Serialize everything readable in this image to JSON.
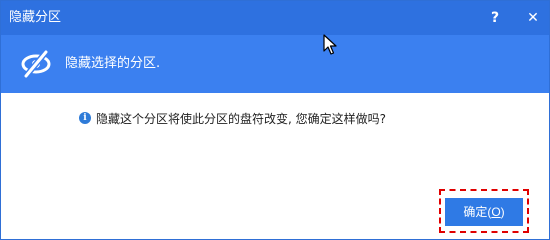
{
  "window": {
    "title": "隐藏分区",
    "help_label": "?",
    "close_label": "✕"
  },
  "header": {
    "icon": "hidden-eye-icon",
    "text": "隐藏选择的分区."
  },
  "message": {
    "icon": "info-icon",
    "icon_glyph": "i",
    "text": "隐藏这个分区将使此分区的盘符改变, 您确定这样做吗?"
  },
  "buttons": {
    "ok_label": "确定(",
    "ok_mnemonic": "O",
    "ok_suffix": ")"
  },
  "colors": {
    "titlebar": "#2e71e0",
    "header": "#3b80f0",
    "button": "#2f7ae5",
    "highlight": "#e00000"
  }
}
